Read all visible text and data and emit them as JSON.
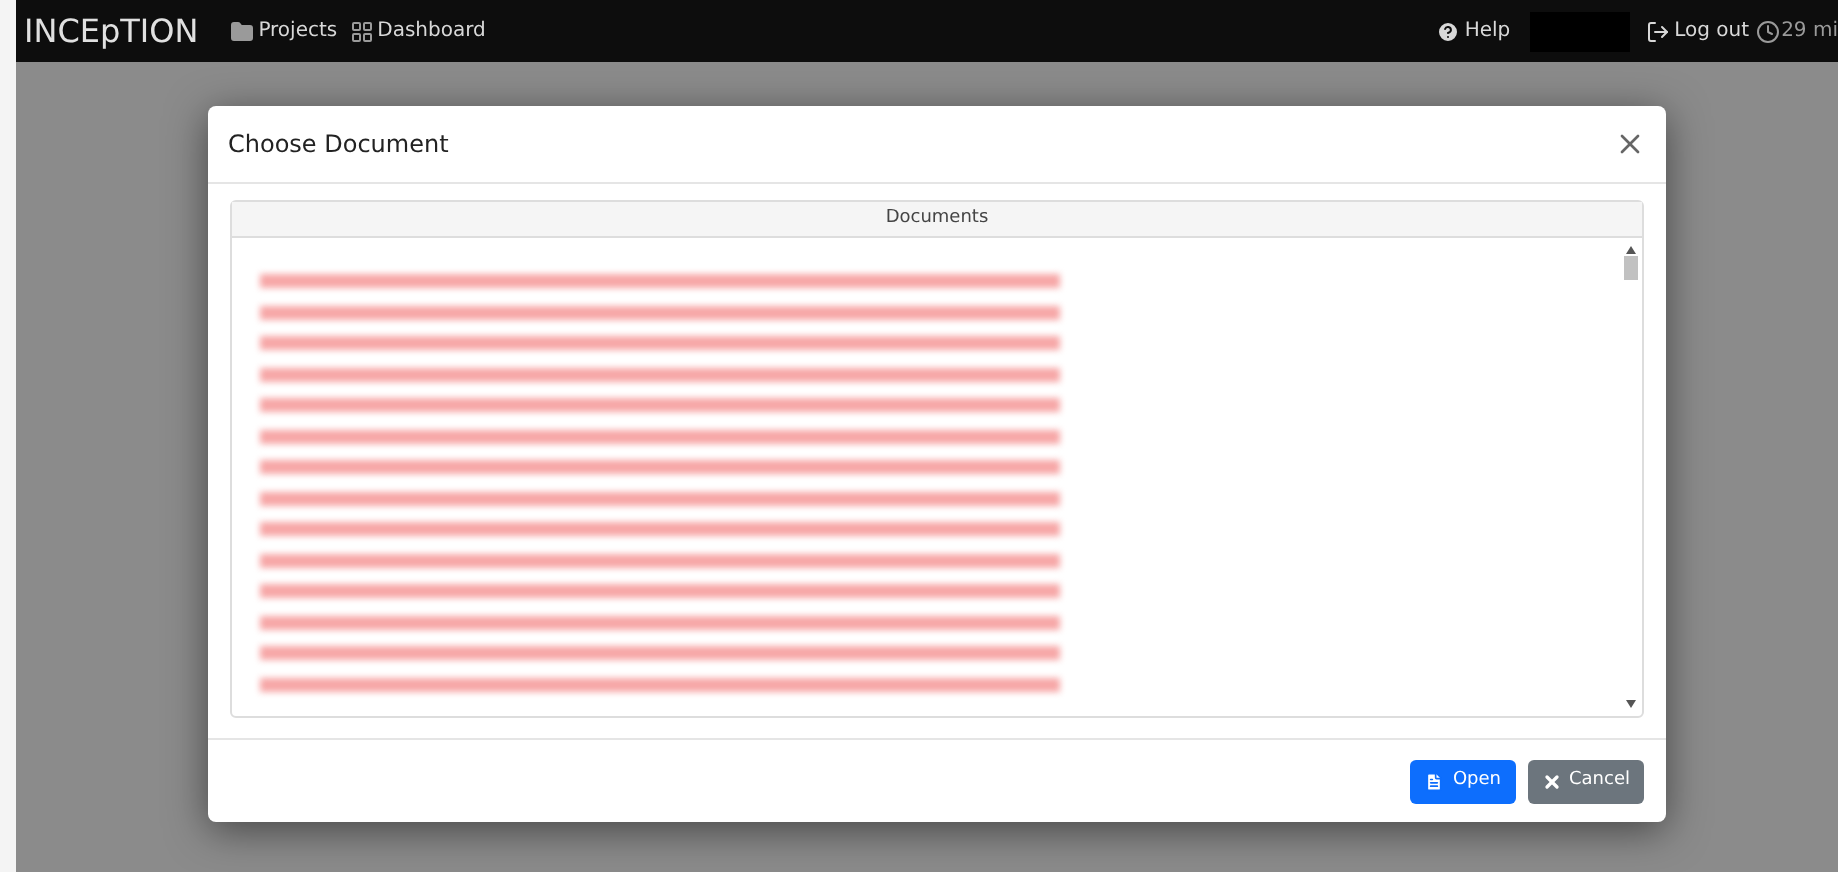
{
  "navbar": {
    "brand": "INCEpTION",
    "links": [
      {
        "label": "Projects",
        "kind": "folder"
      },
      {
        "label": "Dashboard",
        "kind": "grid"
      }
    ],
    "help": "Help",
    "user": {
      "kind": "redacted"
    },
    "logout": "Log out",
    "timer": "29 mi"
  },
  "dialog": {
    "title": "Choose Document",
    "panel_title": "Documents",
    "documents": [
      {
        "kind": "redacted"
      },
      {
        "kind": "redacted"
      },
      {
        "kind": "redacted"
      },
      {
        "kind": "redacted"
      },
      {
        "kind": "redacted"
      },
      {
        "kind": "redacted"
      },
      {
        "kind": "redacted"
      },
      {
        "kind": "redacted"
      },
      {
        "kind": "redacted"
      },
      {
        "kind": "redacted"
      },
      {
        "kind": "redacted"
      },
      {
        "kind": "redacted"
      },
      {
        "kind": "redacted"
      },
      {
        "kind": "redacted"
      }
    ],
    "buttons": [
      {
        "label": "Open",
        "kind": "primary"
      },
      {
        "label": "Cancel",
        "kind": "secondary"
      }
    ]
  }
}
